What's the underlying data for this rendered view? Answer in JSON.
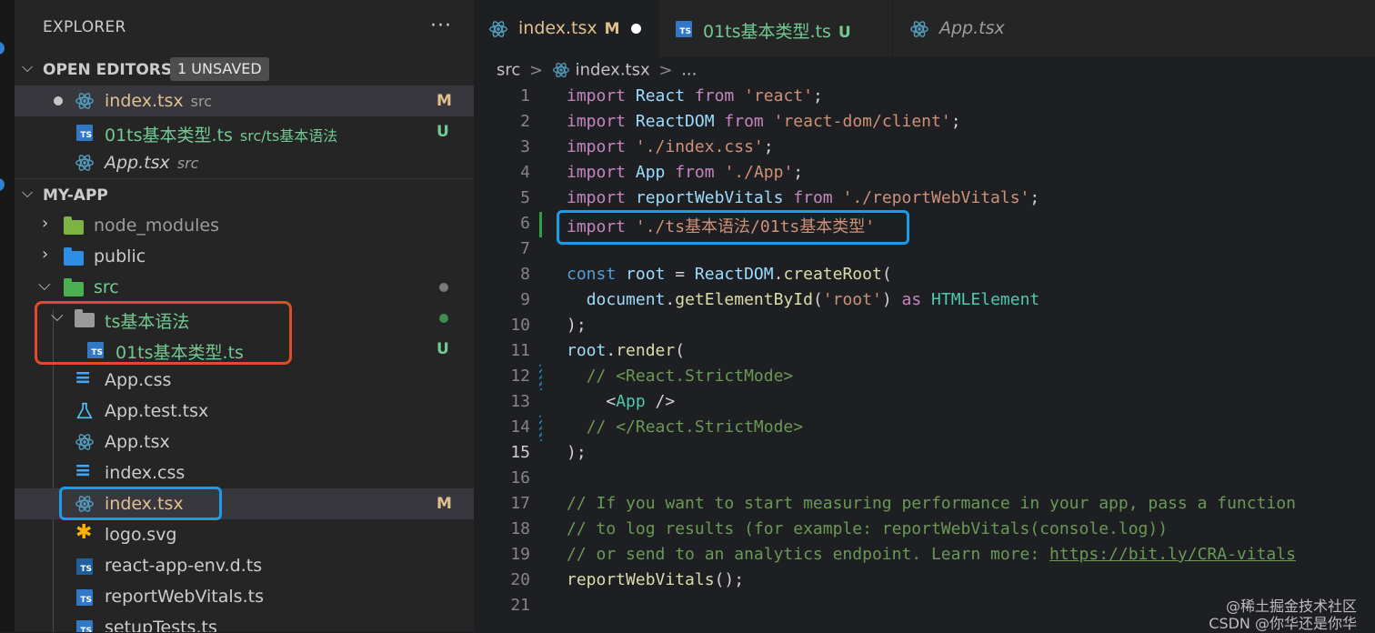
{
  "explorer": {
    "title": "EXPLORER",
    "more": "···",
    "open_editors": {
      "title": "OPEN EDITORS",
      "badge": "1 UNSAVED",
      "items": [
        {
          "name": "index.tsx",
          "desc": "src",
          "status": "M"
        },
        {
          "name": "01ts基本类型.ts",
          "desc": "src/ts基本语法",
          "status": "U"
        },
        {
          "name": "App.tsx",
          "desc": "src",
          "status": ""
        }
      ]
    },
    "project": {
      "title": "MY-APP",
      "tree": [
        {
          "name": "node_modules"
        },
        {
          "name": "public"
        },
        {
          "name": "src"
        },
        {
          "name": "ts基本语法"
        },
        {
          "name": "01ts基本类型.ts",
          "status": "U"
        },
        {
          "name": "App.css"
        },
        {
          "name": "App.test.tsx"
        },
        {
          "name": "App.tsx"
        },
        {
          "name": "index.css"
        },
        {
          "name": "index.tsx",
          "status": "M"
        },
        {
          "name": "logo.svg"
        },
        {
          "name": "react-app-env.d.ts"
        },
        {
          "name": "reportWebVitals.ts"
        },
        {
          "name": "setupTests.ts"
        }
      ]
    }
  },
  "tabs": [
    {
      "label": "index.tsx",
      "badge": "M"
    },
    {
      "label": "01ts基本类型.ts",
      "badge": "U"
    },
    {
      "label": "App.tsx",
      "badge": ""
    }
  ],
  "breadcrumb": {
    "parts": [
      "src",
      "index.tsx",
      "..."
    ],
    "sep": ">"
  },
  "editor": {
    "current_line": 15,
    "lines": [
      "import React from 'react';",
      "import ReactDOM from 'react-dom/client';",
      "import './index.css';",
      "import App from './App';",
      "import reportWebVitals from './reportWebVitals';",
      "import './ts基本语法/01ts基本类型'",
      "",
      "const root = ReactDOM.createRoot(",
      "  document.getElementById('root') as HTMLElement",
      ");",
      "root.render(",
      "  // <React.StrictMode>",
      "    <App />",
      "  // </React.StrictMode>",
      ");",
      "",
      "// If you want to start measuring performance in your app, pass a function",
      "// to log results (for example: reportWebVitals(console.log))",
      "// or send to an analytics endpoint. Learn more: https://bit.ly/CRA-vitals",
      "reportWebVitals();",
      ""
    ]
  },
  "watermark": {
    "line1": "@稀土掘金技术社区",
    "line2": "CSDN @你华还是你华"
  },
  "colors": {
    "modified": "#e2c08d",
    "untracked": "#73c991",
    "react": "#519aba",
    "ts": "#3178c6",
    "highlight_red": "#e14b2c",
    "highlight_blue": "#1a9de6"
  }
}
